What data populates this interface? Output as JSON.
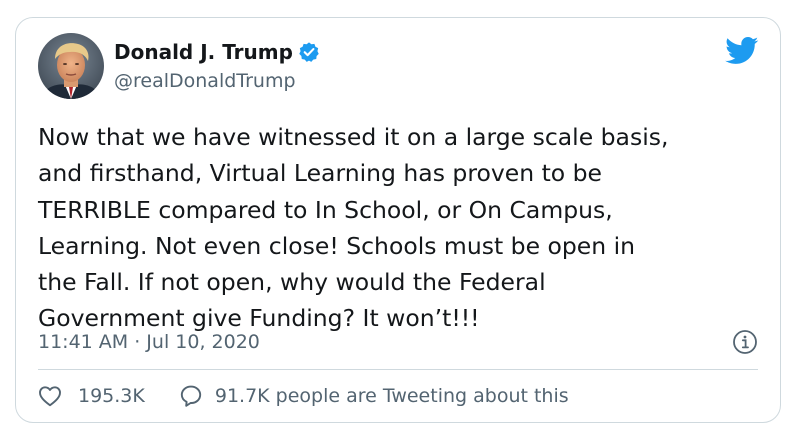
{
  "author": {
    "display_name": "Donald J. Trump",
    "handle": "@realDonaldTrump",
    "verified": true
  },
  "tweet": {
    "lines": [
      "Now that we have witnessed it on a large scale basis,",
      "and firsthand, Virtual Learning has proven to be",
      "TERRIBLE compared to In School, or On Campus,",
      "Learning. Not even close! Schools must be open in",
      "the Fall. If not open, why would the Federal",
      "Government give Funding? It won’t!!!"
    ],
    "timestamp": "11:41 AM · Jul 10, 2020"
  },
  "actions": {
    "likes_count": "195.3K",
    "conversation_text": "91.7K people are Tweeting about this"
  },
  "icons": {
    "brand": "twitter-bird-icon",
    "verified": "verified-badge-icon",
    "info": "info-icon",
    "like": "heart-icon",
    "reply": "speech-bubble-icon"
  },
  "colors": {
    "twitter_blue": "#1d9bf0",
    "text_primary": "#14171a",
    "text_secondary": "#536471",
    "border": "#cfd9de"
  }
}
